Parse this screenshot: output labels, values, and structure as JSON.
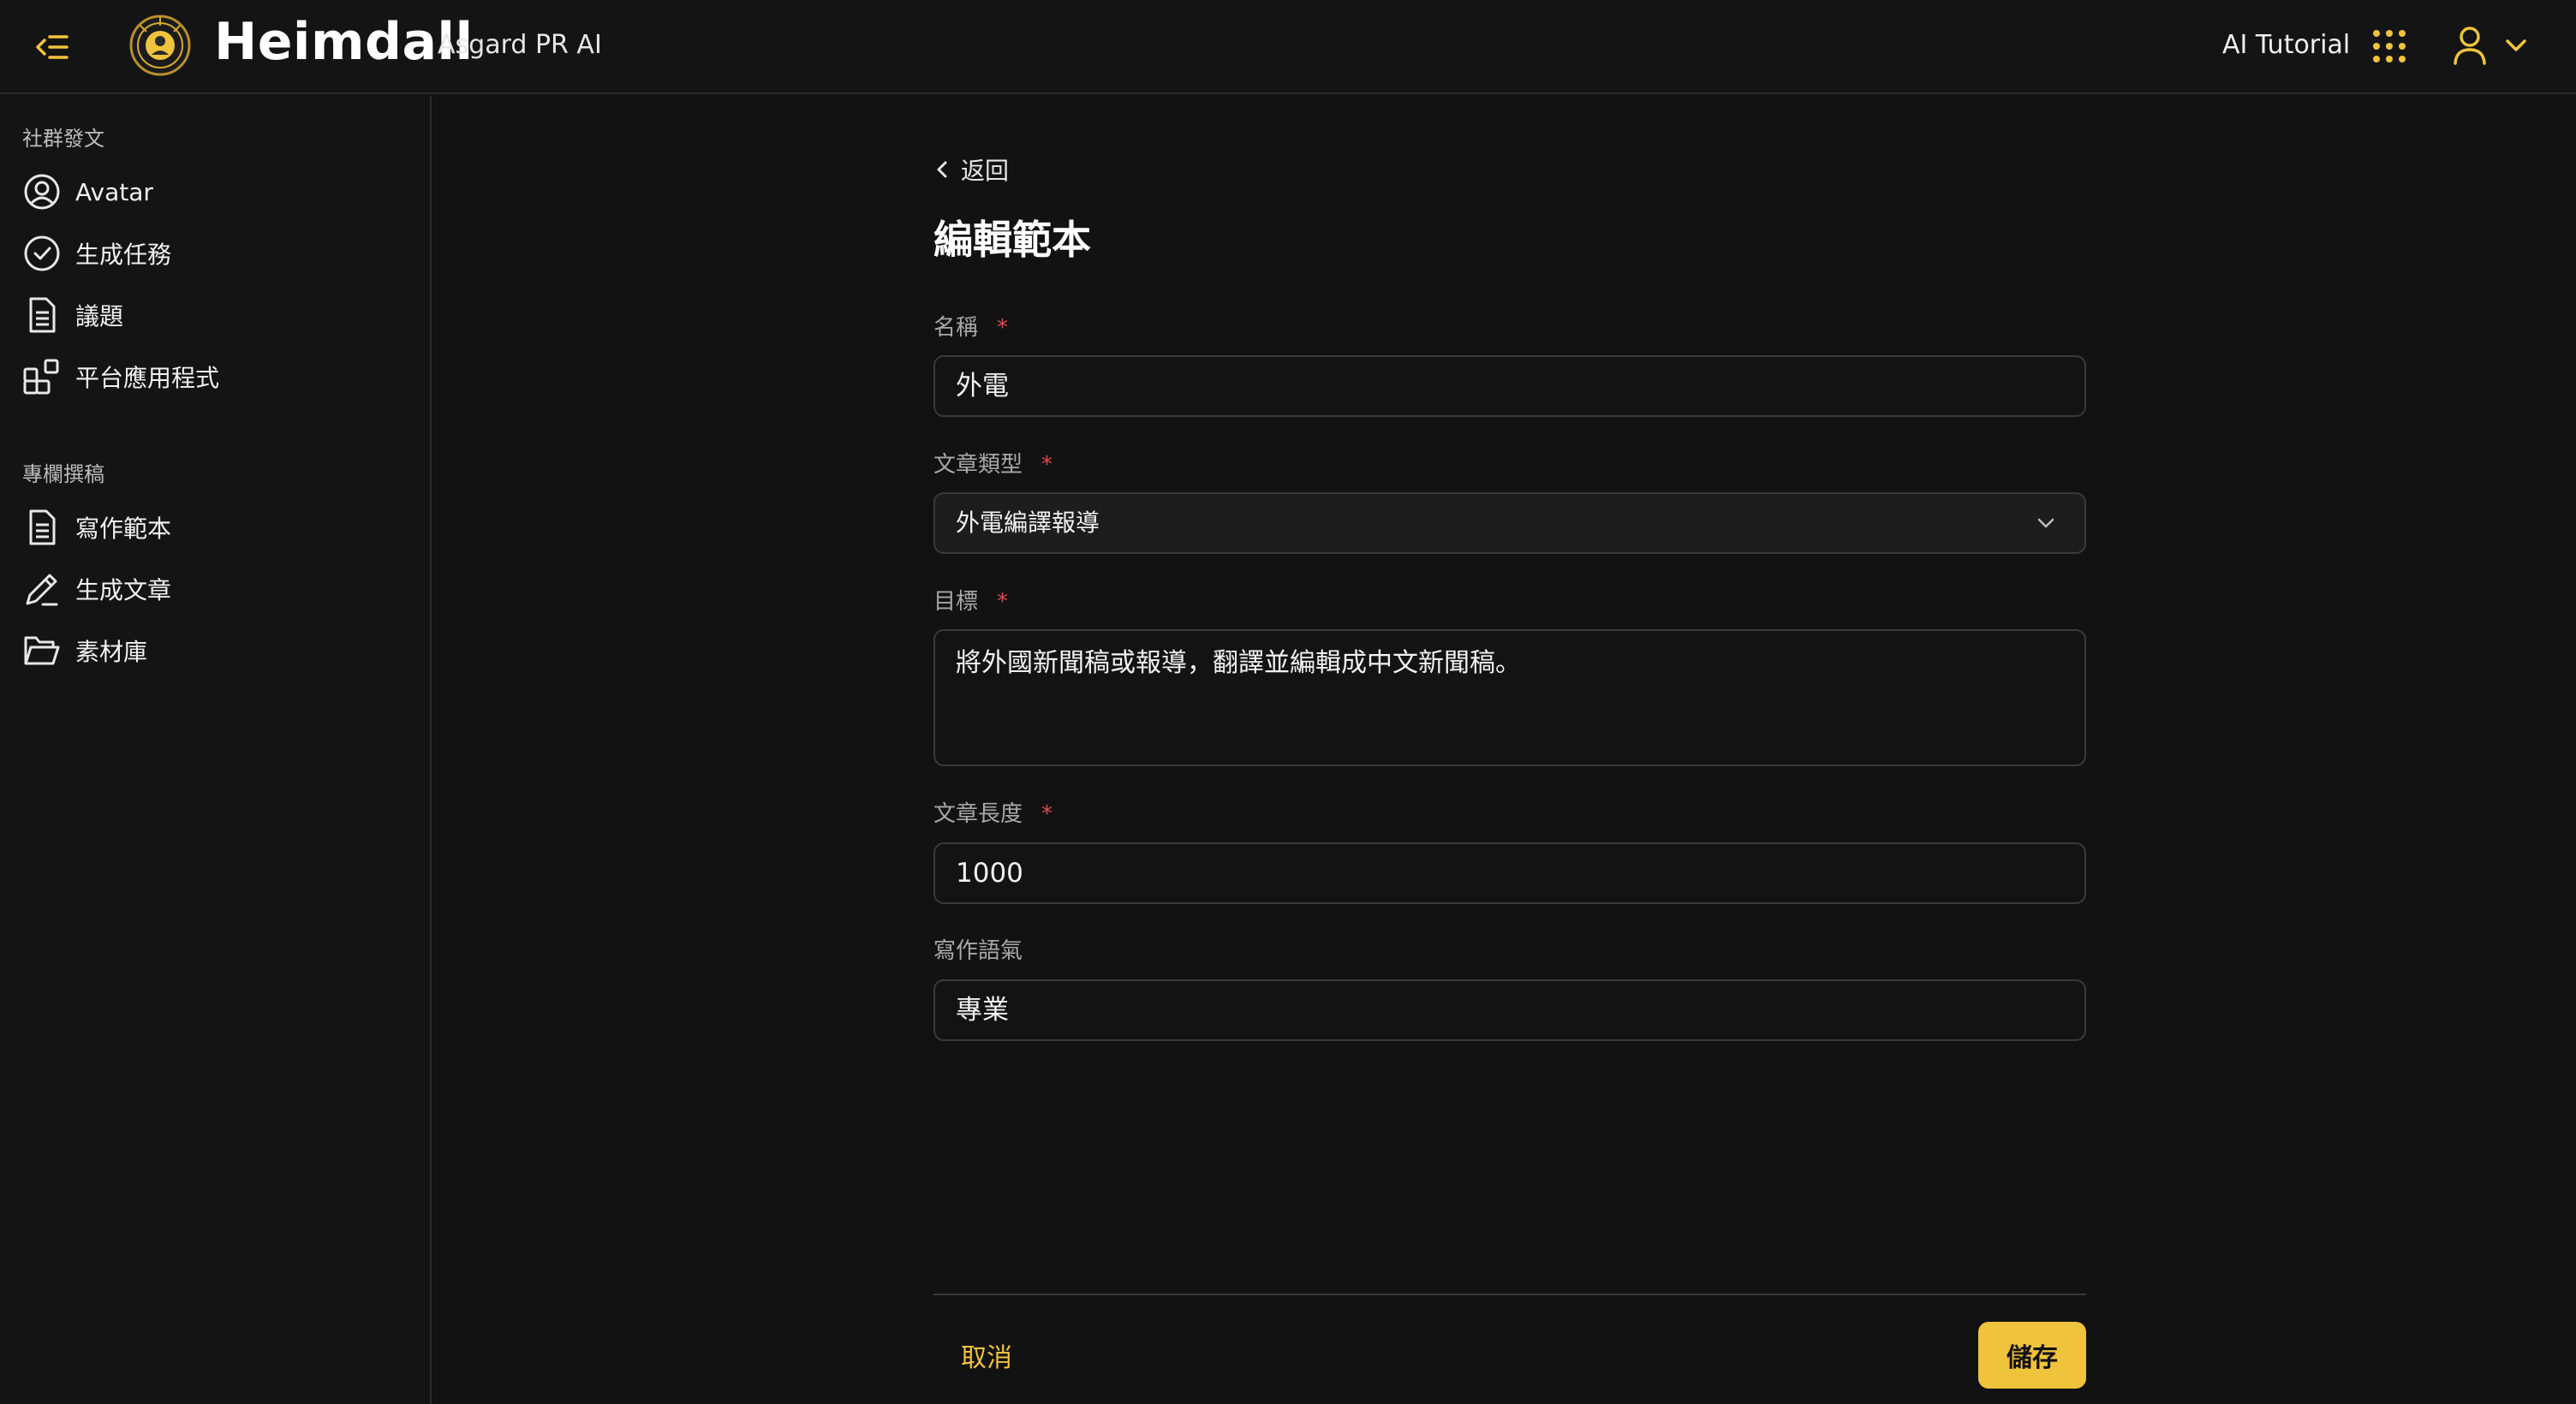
{
  "header": {
    "collapse_icon": "menu-collapse-icon",
    "logo_icon": "heimdall-logo",
    "brand_name": "Heimdall",
    "brand_subtitle": "Asgard PR AI",
    "tutorial_label": "AI Tutorial",
    "apps_icon": "grid-dots-icon",
    "user_icon": "user-icon",
    "user_chevron_icon": "chevron-down-icon"
  },
  "sidebar": {
    "sections": [
      {
        "title": "社群發文",
        "items": [
          {
            "label": "Avatar",
            "icon": "user-circle-icon"
          },
          {
            "label": "生成任務",
            "icon": "check-circle-icon"
          },
          {
            "label": "議題",
            "icon": "document-icon"
          },
          {
            "label": "平台應用程式",
            "icon": "apps-icon"
          }
        ]
      },
      {
        "title": "專欄撰稿",
        "items": [
          {
            "label": "寫作範本",
            "icon": "document-icon"
          },
          {
            "label": "生成文章",
            "icon": "pencil-icon"
          },
          {
            "label": "素材庫",
            "icon": "folder-open-icon"
          }
        ]
      }
    ]
  },
  "main": {
    "back_label": "返回",
    "title": "編輯範本",
    "fields": {
      "name": {
        "label": "名稱",
        "required_mark": "*",
        "value": "外電"
      },
      "article_type": {
        "label": "文章類型",
        "required_mark": "*",
        "value": "外電編譯報導"
      },
      "goal": {
        "label": "目標",
        "required_mark": "*",
        "value": "將外國新聞稿或報導，翻譯並編輯成中文新聞稿。"
      },
      "length": {
        "label": "文章長度",
        "required_mark": "*",
        "value": "1000"
      },
      "tone": {
        "label": "寫作語氣",
        "value": "專業"
      }
    },
    "cancel_label": "取消",
    "save_label": "儲存"
  },
  "colors": {
    "accent": "#f0c33c",
    "required": "#e04a4a",
    "background": "#121212",
    "border": "#3a3a3a"
  }
}
